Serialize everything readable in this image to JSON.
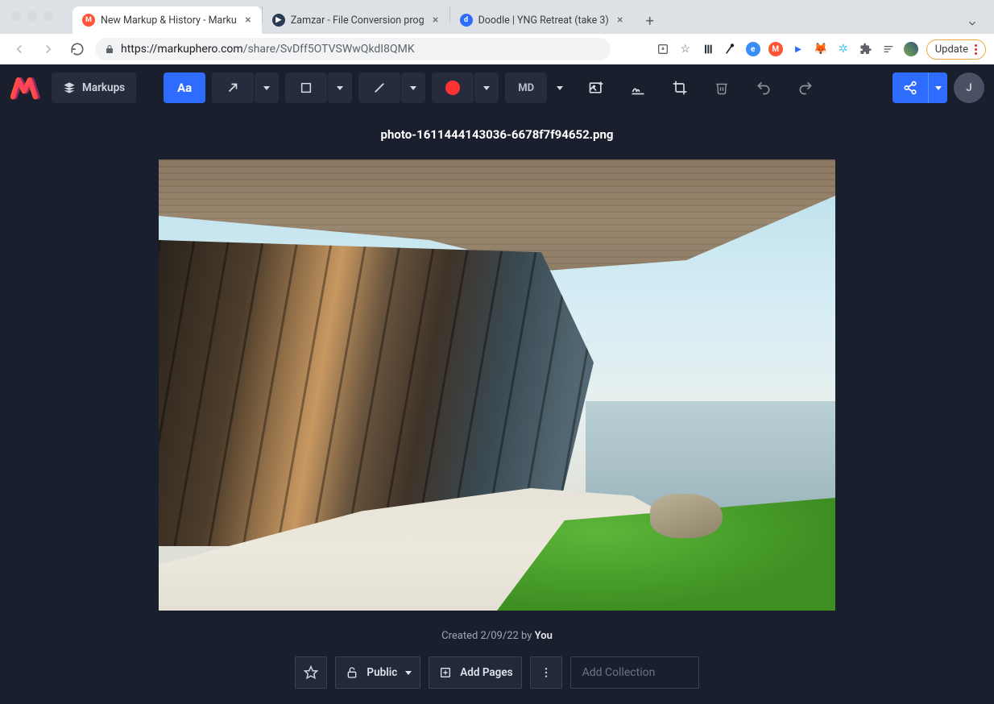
{
  "browser": {
    "tabs": [
      {
        "title": "New Markup & History - Marku",
        "favicon_bg": "#ff5436",
        "favicon_text": "M",
        "active": true
      },
      {
        "title": "Zamzar - File Conversion prog",
        "favicon_bg": "#2b3a55",
        "favicon_text": "▶",
        "active": false
      },
      {
        "title": "Doodle | YNG Retreat (take 3)",
        "favicon_bg": "#2e6bff",
        "favicon_text": "d",
        "active": false
      }
    ],
    "url_host": "markuphero.com",
    "url_path": "/share/SvDff5OTVSWwQkdI8QMK",
    "update_label": "Update"
  },
  "toolbar": {
    "markups_label": "Markups",
    "text_tool_label": "Aa",
    "size_label": "MD",
    "color_hex": "#ff3333",
    "avatar_initial": "J"
  },
  "file": {
    "title": "photo-1611444143036-6678f7f94652.png",
    "created_prefix": "Created ",
    "created_date": "2/09/22",
    "created_by_prefix": " by ",
    "created_by": "You"
  },
  "bottom": {
    "visibility_label": "Public",
    "add_pages_label": "Add Pages",
    "add_collection_placeholder": "Add Collection"
  }
}
